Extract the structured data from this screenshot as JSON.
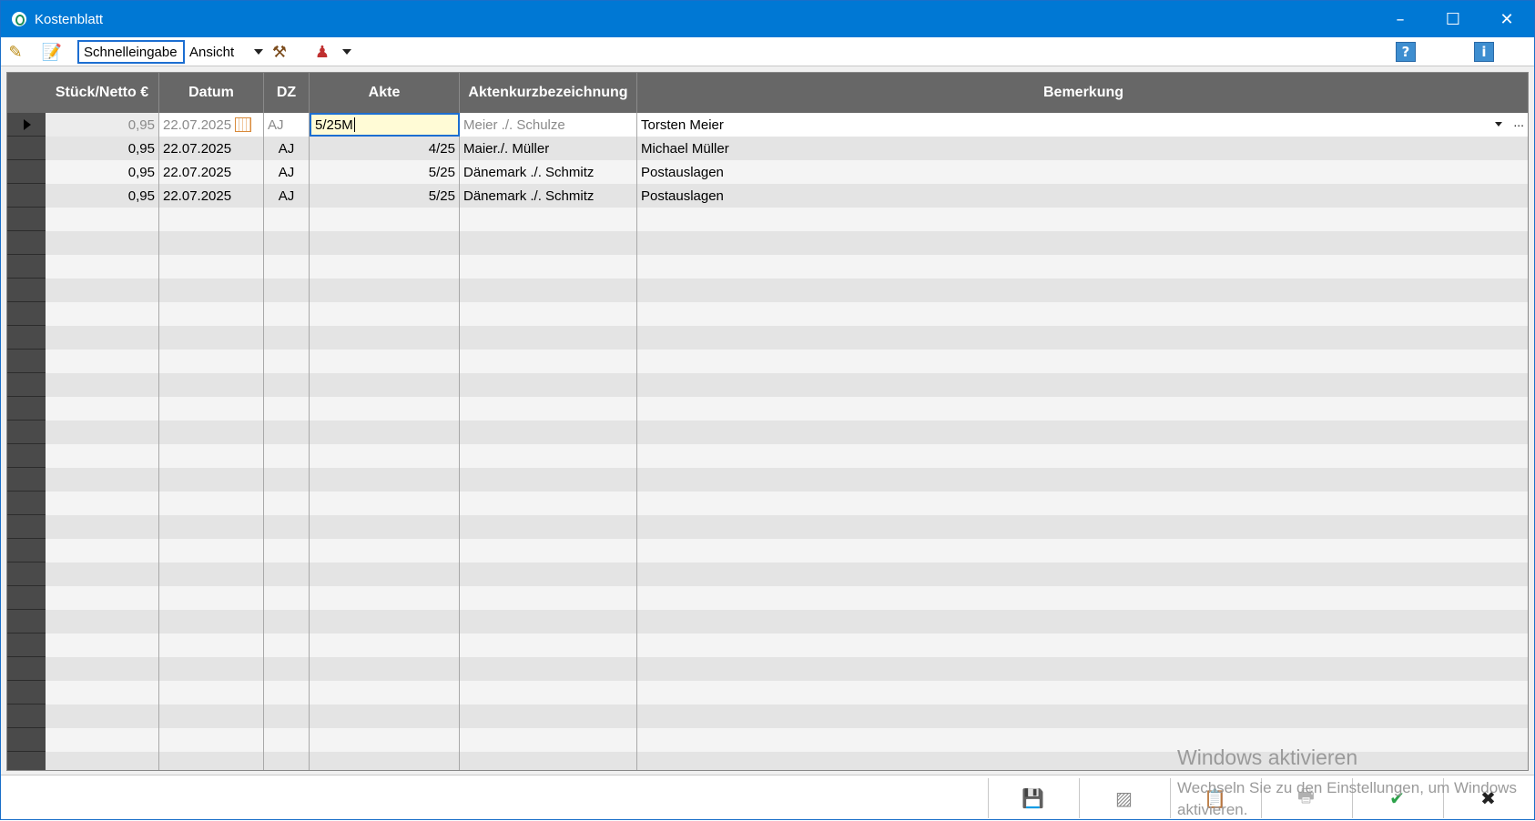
{
  "window": {
    "title": "Kostenblatt",
    "controls": {
      "minimize": "–",
      "maximize": "☐",
      "close": "✕"
    }
  },
  "toolbar": {
    "quick_entry_label": "Schnelleingabe",
    "view_label": "Ansicht",
    "help_label": "?",
    "info_label": "i"
  },
  "grid": {
    "columns": [
      "Stück/Netto €",
      "Datum",
      "DZ",
      "Akte",
      "Aktenkurzbezeichnung",
      "Bemerkung"
    ],
    "edit_row": {
      "qty": "0,95",
      "date": "22.07.2025",
      "dz": "AJ",
      "akte": "5/25M",
      "kurz": "Meier ./. Schulze",
      "bemerkung": "Torsten Meier",
      "more": "..."
    },
    "rows": [
      {
        "qty": "0,95",
        "date": "22.07.2025",
        "dz": "AJ",
        "akte": "4/25",
        "kurz": "Maier./. Müller",
        "bemerkung": "Michael Müller"
      },
      {
        "qty": "0,95",
        "date": "22.07.2025",
        "dz": "AJ",
        "akte": "5/25",
        "kurz": "Dänemark ./. Schmitz",
        "bemerkung": "Postauslagen"
      },
      {
        "qty": "0,95",
        "date": "22.07.2025",
        "dz": "AJ",
        "akte": "5/25",
        "kurz": "Dänemark ./. Schmitz",
        "bemerkung": "Postauslagen"
      }
    ]
  },
  "footer": {
    "buttons": [
      "save-icon",
      "edit-image-icon",
      "clipboard-icon",
      "print-icon",
      "check-icon",
      "close-icon"
    ]
  },
  "watermark": {
    "line1": "Windows aktivieren",
    "line2": "Wechseln Sie zu den Einstellungen, um Windows aktivieren."
  },
  "colors": {
    "titlebar": "#0078d4",
    "header": "#676767",
    "row_even": "#f4f4f4",
    "row_odd": "#e4e4e4",
    "active_cell": "#fffbd6"
  }
}
